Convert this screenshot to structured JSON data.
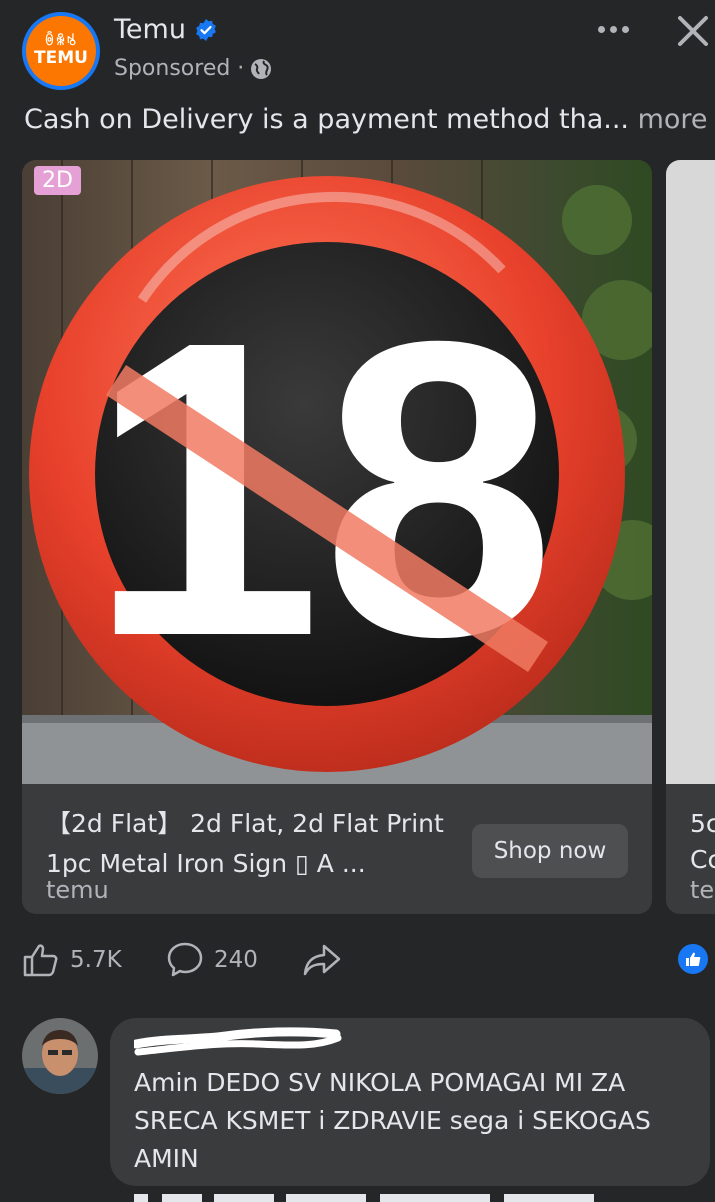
{
  "header": {
    "logo_glyphs": "ꉺꆜꂚ",
    "logo_word": "TEMU",
    "page_name": "Temu",
    "sponsored": "Sponsored ·"
  },
  "post": {
    "caption": "Cash on Delivery is a payment method tha...",
    "caption_more": "more"
  },
  "carousel": {
    "card1": {
      "badge": "2D",
      "title": "【2d Flat】 2d Flat, 2d Flat Print 1pc Metal Iron Sign ▯ A ...",
      "domain": "temu",
      "button": "Shop now",
      "sign_text": "18"
    },
    "card2": {
      "title_line1": "5c",
      "title_line2": "Cc",
      "domain": "te"
    }
  },
  "actions": {
    "likes": "5.7K",
    "comments": "240"
  },
  "comment": {
    "text": "Amin DEDO SV NIKOLA POMAGAI MI ZA SRECA KSMET i ZDRAVIE sega i SEKOGAS AMIN"
  },
  "colors": {
    "background": "#252628",
    "card": "#3a3b3d",
    "brand": "#fb7701",
    "accent_blue": "#1877f2",
    "sign_red": "#e8412c"
  },
  "icons": [
    "temu-logo",
    "verified-badge-icon",
    "globe-icon",
    "more-options-icon",
    "close-icon",
    "like-icon",
    "comment-icon",
    "share-icon",
    "like-reaction-icon"
  ]
}
